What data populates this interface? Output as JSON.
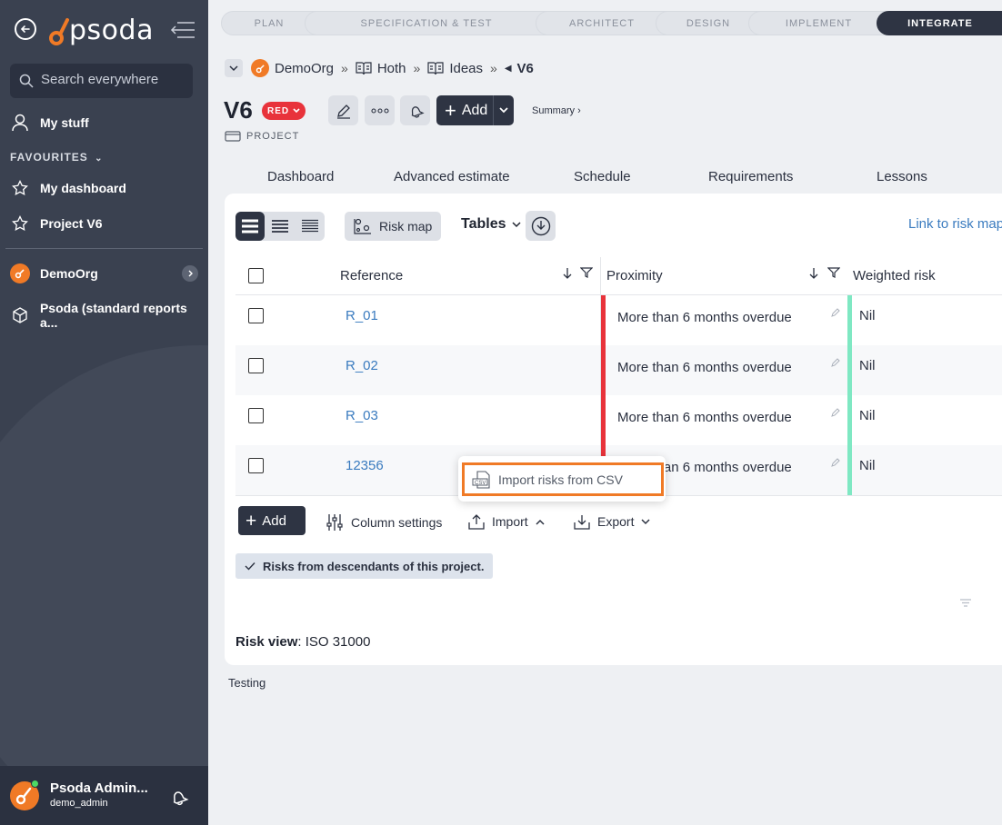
{
  "sidebar": {
    "logo_text": "psoda",
    "search_placeholder": "Search everywhere",
    "my_stuff": "My stuff",
    "favourites_heading": "FAVOURITES",
    "favourites": [
      {
        "label": "My dashboard"
      },
      {
        "label": "Project V6"
      }
    ],
    "org": "DemoOrg",
    "reports": "Psoda (standard reports a...",
    "user_name": "Psoda Admin...",
    "user_login": "demo_admin"
  },
  "phases": [
    {
      "label": "PLAN"
    },
    {
      "label": "SPECIFICATION & TEST"
    },
    {
      "label": "ARCHITECT"
    },
    {
      "label": "DESIGN"
    },
    {
      "label": "IMPLEMENT"
    },
    {
      "label": "INTEGRATE"
    }
  ],
  "breadcrumb": [
    {
      "label": "DemoOrg"
    },
    {
      "label": "Hoth"
    },
    {
      "label": "Ideas"
    },
    {
      "label": "V6"
    }
  ],
  "header": {
    "title": "V6",
    "status_badge": "RED",
    "add_label": "Add",
    "summary_label": "Summary",
    "type_label": "PROJECT"
  },
  "tabs": [
    {
      "label": "Dashboard"
    },
    {
      "label": "Advanced estimate"
    },
    {
      "label": "Schedule"
    },
    {
      "label": "Requirements"
    },
    {
      "label": "Lessons"
    }
  ],
  "toolbar": {
    "risk_map_label": "Risk map",
    "tables_label": "Tables",
    "link_label": "Link to risk map"
  },
  "table": {
    "columns": [
      "Reference",
      "Proximity",
      "Weighted risk"
    ],
    "rows": [
      {
        "reference": "R_01",
        "proximity": "More than 6 months overdue",
        "weighted_risk": "Nil"
      },
      {
        "reference": "R_02",
        "proximity": "More than 6 months overdue",
        "weighted_risk": "Nil"
      },
      {
        "reference": "R_03",
        "proximity": "More than 6 months overdue",
        "weighted_risk": "Nil"
      },
      {
        "reference": "12356",
        "proximity": "More than 6 months overdue",
        "weighted_risk": "Nil"
      }
    ]
  },
  "actions": {
    "add_label": "Add",
    "column_settings_label": "Column settings",
    "import_label": "Import",
    "export_label": "Export"
  },
  "descendants_tag": "Risks from descendants of this project.",
  "risk_view_label": "Risk view",
  "risk_view_value": ": ISO 31000",
  "popup": {
    "import_csv_label": "Import risks from CSV"
  },
  "footer_text": "Testing",
  "colors": {
    "accent": "#f07a26",
    "status_red": "#e8333b",
    "weighted_green": "#7fe8c3",
    "dark": "#2e3443"
  }
}
